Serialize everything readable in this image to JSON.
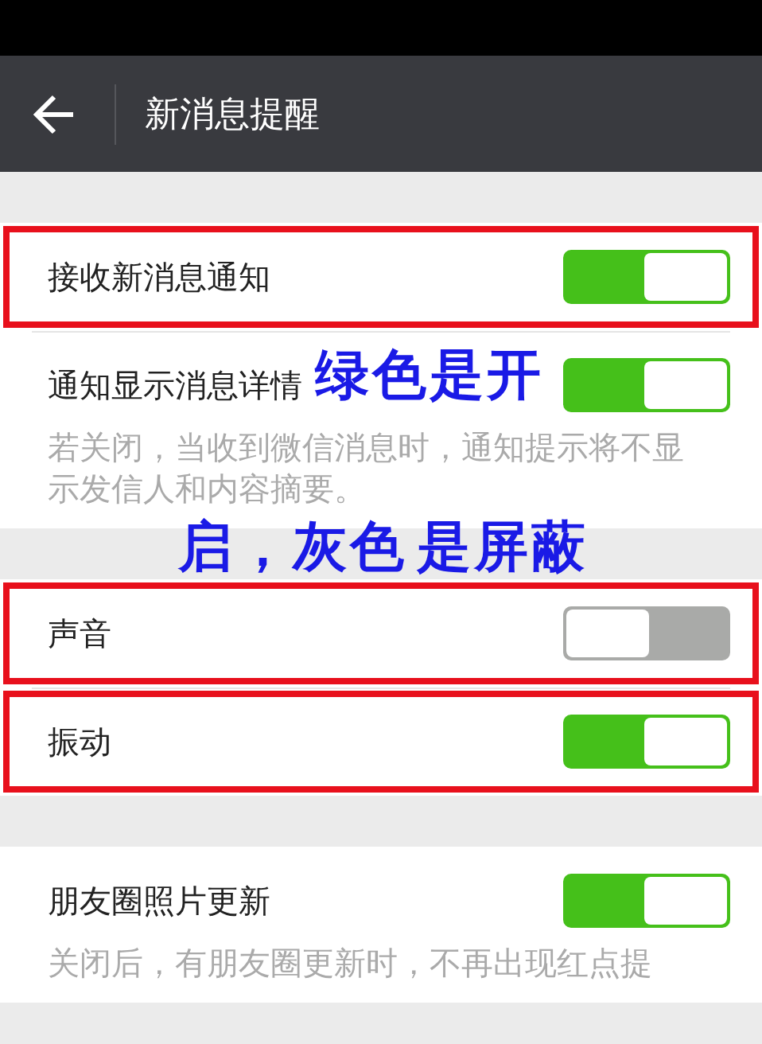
{
  "header": {
    "title": "新消息提醒"
  },
  "sections": [
    {
      "rows": [
        {
          "label": "接收新消息通知",
          "on": true,
          "highlighted": true
        },
        {
          "label": "通知显示消息详情",
          "on": true,
          "highlighted": false,
          "hint": "若关闭，当收到微信消息时，通知提示将不显示发信人和内容摘要。"
        }
      ]
    },
    {
      "rows": [
        {
          "label": "声音",
          "on": false,
          "highlighted": true
        },
        {
          "label": "振动",
          "on": true,
          "highlighted": true
        }
      ]
    },
    {
      "rows": [
        {
          "label": "朋友圈照片更新",
          "on": true,
          "highlighted": false,
          "hint": "关闭后，有朋友圈更新时，不再出现红点提"
        }
      ]
    }
  ],
  "annotation": {
    "lines": [
      "绿色是开",
      "启，灰色",
      "是屏蔽"
    ]
  }
}
